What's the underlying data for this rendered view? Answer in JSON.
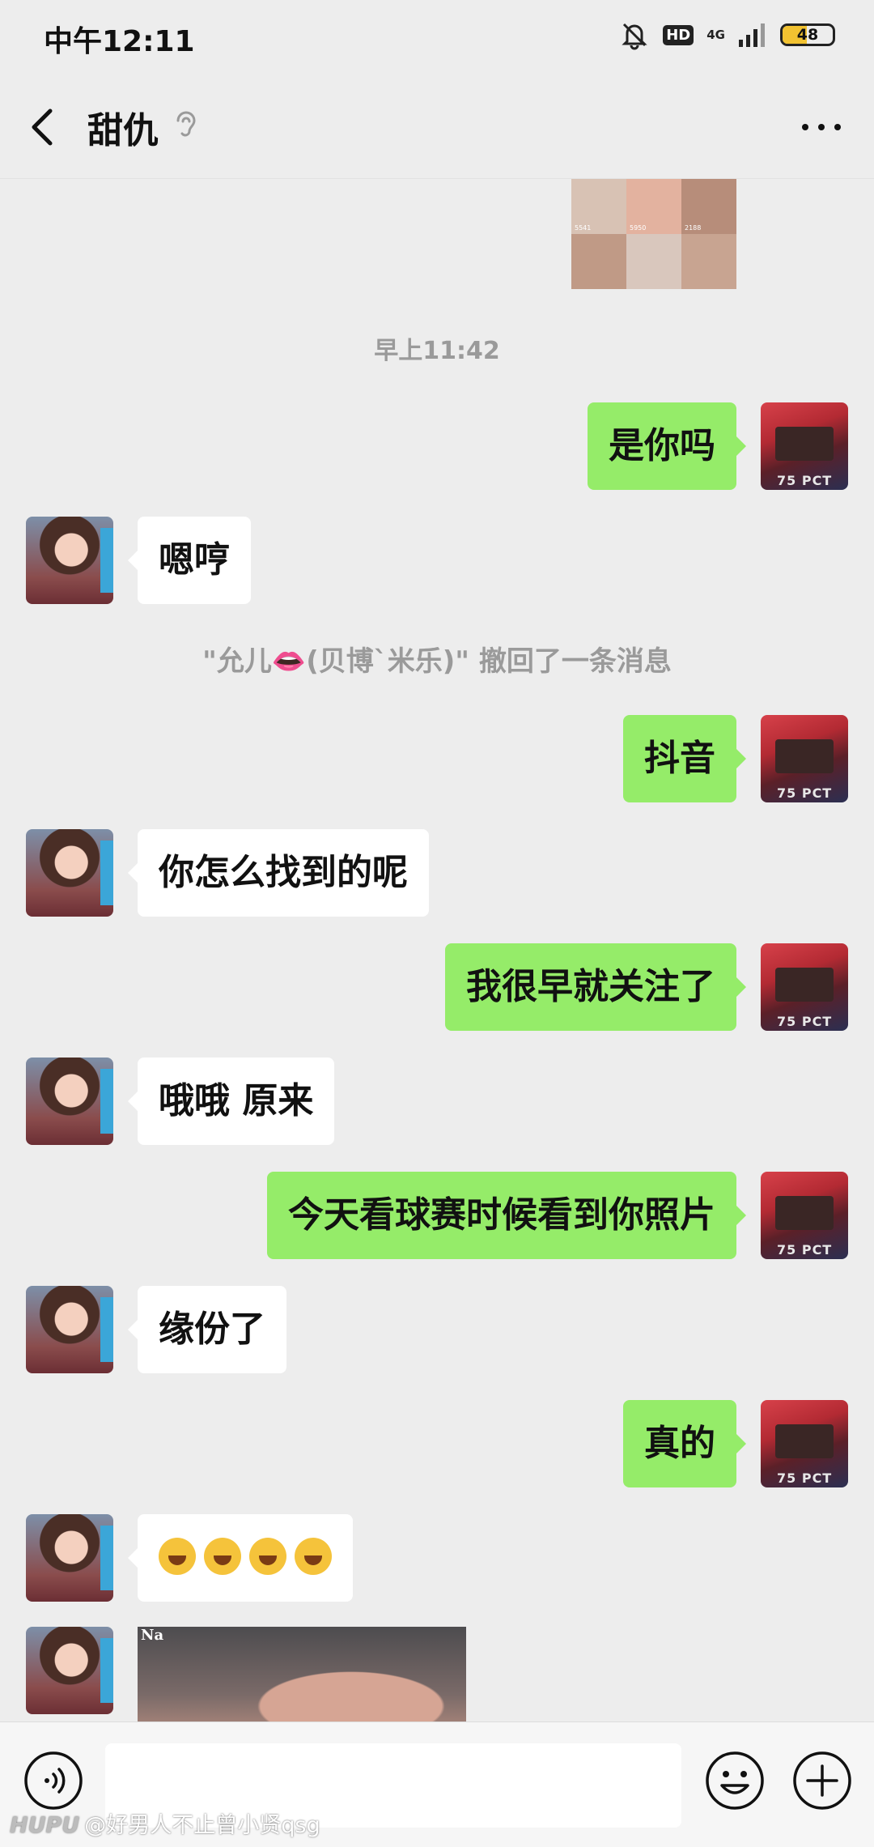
{
  "status_bar": {
    "time": "中午12:11",
    "hd": "HD",
    "network": "4G",
    "battery": "48",
    "battery_level_percent": 48
  },
  "header": {
    "title": "甜仇"
  },
  "chat": {
    "timestamp": "早上11:42",
    "system_notice": "\"允儿👄(贝博`米乐)\" 撤回了一条消息",
    "thumb_views": [
      "5541",
      "5950",
      "2188"
    ],
    "messages": [
      {
        "from": "me",
        "text": "是你吗"
      },
      {
        "from": "them",
        "text": "嗯哼"
      },
      {
        "from": "me",
        "text": "抖音"
      },
      {
        "from": "them",
        "text": "你怎么找到的呢"
      },
      {
        "from": "me",
        "text": "我很早就关注了"
      },
      {
        "from": "them",
        "text": "哦哦 原来"
      },
      {
        "from": "me",
        "text": "今天看球赛时候看到你照片"
      },
      {
        "from": "them",
        "text": "缘份了"
      },
      {
        "from": "me",
        "text": "真的"
      },
      {
        "from": "them",
        "emoji": "rofl",
        "count": 4
      }
    ],
    "photo_label": "Na",
    "avatar_text": "75 PCT"
  },
  "input_bar": {
    "voice_icon": "voice-icon",
    "emoji_icon": "smile-icon",
    "plus_icon": "plus-icon"
  },
  "watermark": {
    "brand": "HUPU",
    "text": "@好男人不止曾小贤qsg"
  },
  "colors": {
    "bg": "#ededed",
    "outgoing": "#95ec69",
    "incoming": "#ffffff"
  }
}
